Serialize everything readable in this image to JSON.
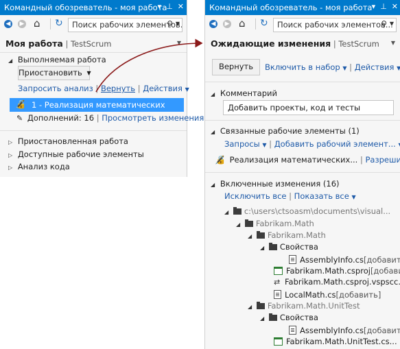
{
  "left": {
    "title": "Командный обозреватель - моя работа",
    "search_placeholder": "Поиск рабочих элементов...",
    "header_title": "Моя работа",
    "header_sep": "|",
    "header_sub": "TestScrum",
    "in_progress": {
      "label": "Выполняемая работа",
      "suspend_button": "Приостановить",
      "link_request_review": "Запросить анализ",
      "link_undo": "Вернуть",
      "link_actions": "Действия",
      "work_item": "1 - Реализация математических",
      "additions_label": "Дополнений: 16",
      "view_changes": "Просмотреть изменения"
    },
    "sections": [
      "Приостановленная работа",
      "Доступные рабочие элементы",
      "Анализ кода"
    ]
  },
  "right": {
    "title": "Командный обозреватель - моя работа",
    "search_placeholder": "Поиск рабочих элементов...",
    "header_title": "Ожидающие изменения",
    "header_sep": "|",
    "header_sub": "TestScrum",
    "buttons": {
      "undo": "Вернуть",
      "include_in_set": "Включить в набор",
      "actions": "Действия"
    },
    "comment": {
      "label": "Комментарий",
      "value": "Добавить проекты, код и тесты"
    },
    "related": {
      "label": "Связанные рабочие элементы (1)",
      "queries": "Запросы",
      "add_item": "Добавить рабочий элемент...",
      "item": "Реализация математических...",
      "resolve": "Разрешить"
    },
    "included": {
      "label": "Включенные изменения (16)",
      "exclude_all": "Исключить все",
      "show_all": "Показать все"
    },
    "tree": [
      {
        "label": "c:\\users\\ctsoasm\\documents\\visual...",
        "icon": "folder-icon",
        "tag": ""
      },
      {
        "label": "Fabrikam.Math",
        "icon": "folder-icon",
        "tag": ""
      },
      {
        "label": "Fabrikam.Math",
        "icon": "folder-icon",
        "tag": ""
      },
      {
        "label": "Свойства",
        "icon": "folder-icon",
        "tag": ""
      },
      {
        "label": "AssemblyInfo.cs",
        "icon": "file-icon",
        "tag": "[добавить]"
      },
      {
        "label": "Fabrikam.Math.csproj",
        "icon": "project-icon",
        "tag": "[добавить]"
      },
      {
        "label": "Fabrikam.Math.csproj.vspscc...",
        "icon": "swap-icon",
        "tag": ""
      },
      {
        "label": "LocalMath.cs",
        "icon": "file-icon",
        "tag": "[добавить]"
      },
      {
        "label": "Fabrikam.Math.UnitTest",
        "icon": "folder-icon",
        "tag": ""
      },
      {
        "label": "Свойства",
        "icon": "folder-icon",
        "tag": ""
      },
      {
        "label": "AssemblyInfo.cs",
        "icon": "file-icon",
        "tag": "[добавить]"
      },
      {
        "label": "Fabrikam.Math.UnitTest.cs...",
        "icon": "project-icon",
        "tag": ""
      }
    ]
  },
  "colors": {
    "titlebar": "#007acc",
    "selection": "#3399ff",
    "link": "#1e5aa8",
    "arrow": "#8b1a1a"
  }
}
